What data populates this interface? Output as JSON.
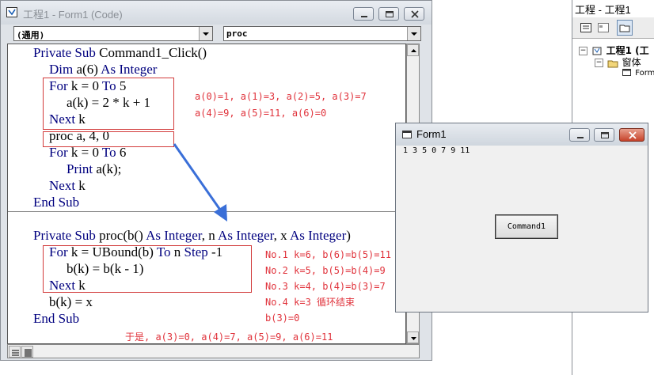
{
  "code_window": {
    "title": "工程1 - Form1 (Code)",
    "object_combo": "(通用)",
    "proc_combo": "proc",
    "lines": [
      {
        "indent": 0,
        "parts": [
          {
            "t": "Private Sub ",
            "kw": true
          },
          {
            "t": "Command1_Click()",
            "kw": false
          }
        ]
      },
      {
        "indent": 1,
        "parts": [
          {
            "t": "Dim ",
            "kw": true
          },
          {
            "t": "a(6) ",
            "kw": false
          },
          {
            "t": "As Integer",
            "kw": true
          }
        ]
      },
      {
        "indent": 1,
        "parts": [
          {
            "t": "For ",
            "kw": true
          },
          {
            "t": "k = 0 ",
            "kw": false
          },
          {
            "t": "To ",
            "kw": true
          },
          {
            "t": "5",
            "kw": false
          }
        ]
      },
      {
        "indent": 2,
        "parts": [
          {
            "t": "a(k) = 2 * k + 1",
            "kw": false
          }
        ]
      },
      {
        "indent": 1,
        "parts": [
          {
            "t": "Next ",
            "kw": true
          },
          {
            "t": "k",
            "kw": false
          }
        ]
      },
      {
        "indent": 1,
        "parts": [
          {
            "t": "proc a, 4, 0",
            "kw": false
          }
        ]
      },
      {
        "indent": 1,
        "parts": [
          {
            "t": "For ",
            "kw": true
          },
          {
            "t": "k = 0 ",
            "kw": false
          },
          {
            "t": "To ",
            "kw": true
          },
          {
            "t": "6",
            "kw": false
          }
        ]
      },
      {
        "indent": 2,
        "parts": [
          {
            "t": "Print ",
            "kw": true
          },
          {
            "t": "a(k);",
            "kw": false
          }
        ]
      },
      {
        "indent": 1,
        "parts": [
          {
            "t": "Next ",
            "kw": true
          },
          {
            "t": "k",
            "kw": false
          }
        ]
      },
      {
        "indent": 0,
        "parts": [
          {
            "t": "End Sub",
            "kw": true
          }
        ]
      },
      {
        "indent": 0,
        "parts": [
          {
            "t": "Private Sub ",
            "kw": true
          },
          {
            "t": "proc(b() ",
            "kw": false
          },
          {
            "t": "As Integer",
            "kw": true
          },
          {
            "t": ", n ",
            "kw": false
          },
          {
            "t": "As Integer",
            "kw": true
          },
          {
            "t": ", x ",
            "kw": false
          },
          {
            "t": "As Integer",
            "kw": true
          },
          {
            "t": ")",
            "kw": false
          }
        ]
      },
      {
        "indent": 1,
        "parts": [
          {
            "t": "For ",
            "kw": true
          },
          {
            "t": "k = UBound(b) ",
            "kw": false
          },
          {
            "t": "To ",
            "kw": true
          },
          {
            "t": "n ",
            "kw": false
          },
          {
            "t": "Step ",
            "kw": true
          },
          {
            "t": "-1",
            "kw": false
          }
        ]
      },
      {
        "indent": 2,
        "parts": [
          {
            "t": "b(k) = b(k - 1)",
            "kw": false
          }
        ]
      },
      {
        "indent": 1,
        "parts": [
          {
            "t": "Next ",
            "kw": true
          },
          {
            "t": "k",
            "kw": false
          }
        ]
      },
      {
        "indent": 1,
        "parts": [
          {
            "t": "b(k) = x",
            "kw": false
          }
        ]
      },
      {
        "indent": 0,
        "parts": [
          {
            "t": "End Sub",
            "kw": true
          }
        ]
      }
    ]
  },
  "annotations": {
    "init_line1": "a(0)=1, a(1)=3, a(2)=5, a(3)=7",
    "init_line2": "a(4)=9, a(5)=11, a(6)=0",
    "steps": [
      "No.1 k=6, b(6)=b(5)=11",
      "No.2 k=5, b(5)=b(4)=9",
      "No.3 k=4, b(4)=b(3)=7",
      "No.4 k=3 循环结束",
      "b(3)=0"
    ],
    "result": "于是, a(3)=0, a(4)=7, a(5)=9, a(6)=11"
  },
  "project": {
    "title": "工程 - 工程1",
    "root": "工程1 (工",
    "folder": "窗体",
    "form": "Form"
  },
  "form_window": {
    "title": "Form1",
    "output": "1  3  5  0  7  9  11",
    "button_label": "Command1"
  },
  "colors": {
    "keyword": "#00007f",
    "annotation": "#e0323b",
    "arrow": "#3a6fd8"
  }
}
